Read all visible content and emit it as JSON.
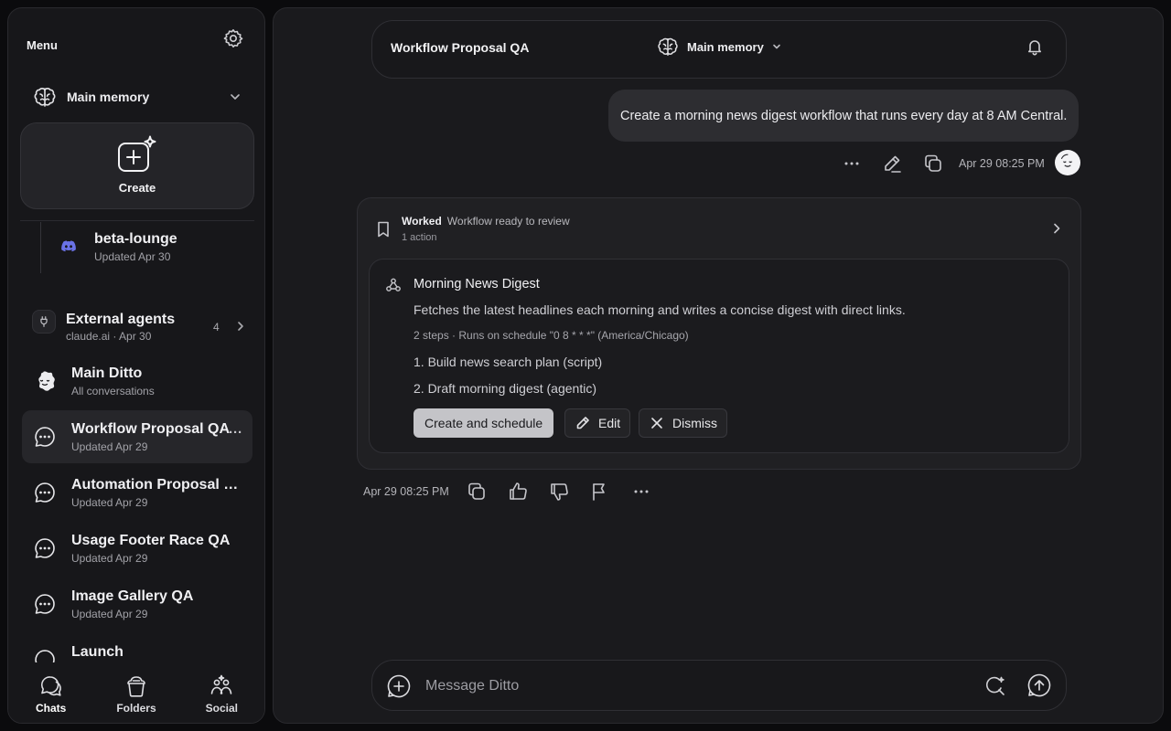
{
  "sidebar": {
    "menu_label": "Menu",
    "memory": {
      "label": "Main memory"
    },
    "create_label": "Create",
    "discord_item": {
      "name": "beta-lounge",
      "sub": "Updated Apr 30"
    },
    "external_agents": {
      "name": "External agents",
      "sub": "claude.ai · Apr 30",
      "count": "4"
    },
    "chats": [
      {
        "name": "Main Ditto",
        "sub": "All conversations",
        "icon": "ditto-face-icon"
      },
      {
        "name": "Workflow Proposal QA",
        "sub": "Updated Apr 29",
        "icon": "chat-bubble-icon",
        "active": true,
        "more": "···"
      },
      {
        "name": "Automation Proposal Race QA",
        "sub": "Updated Apr 29",
        "icon": "chat-bubble-icon"
      },
      {
        "name": "Usage Footer Race QA",
        "sub": "Updated Apr 29",
        "icon": "chat-bubble-icon"
      },
      {
        "name": "Image Gallery QA",
        "sub": "Updated Apr 29",
        "icon": "chat-bubble-icon"
      },
      {
        "name": "Launch",
        "sub": "",
        "icon": "chat-bubble-icon"
      }
    ],
    "nav": [
      {
        "label": "Chats",
        "icon": "chats-icon"
      },
      {
        "label": "Folders",
        "icon": "folders-icon"
      },
      {
        "label": "Social",
        "icon": "social-icon"
      }
    ]
  },
  "header": {
    "title": "Workflow Proposal QA",
    "memory_label": "Main memory"
  },
  "conversation": {
    "user_message": "Create a morning news digest workflow that runs every day at 8 AM Central.",
    "user_timestamp": "Apr 29 08:25 PM",
    "ai": {
      "status_label": "Worked",
      "status_text": "Workflow ready to review",
      "actions_count": "1 action",
      "workflow": {
        "title": "Morning News Digest",
        "description": "Fetches the latest headlines each morning and writes a concise digest with direct links.",
        "meta": "2 steps · Runs on schedule \"0 8 * * *\" (America/Chicago)",
        "steps": [
          "1. Build news search plan (script)",
          "2. Draft morning digest (agentic)"
        ],
        "buttons": {
          "primary": "Create and schedule",
          "edit": "Edit",
          "dismiss": "Dismiss"
        }
      },
      "timestamp": "Apr 29 08:25 PM"
    }
  },
  "composer": {
    "placeholder": "Message Ditto"
  },
  "colors": {
    "background": "#0b0b0d",
    "panel": "#17171a",
    "main": "#1a1a1d",
    "primary_button": "#c4c4c8",
    "discord": "#6a72e6"
  }
}
